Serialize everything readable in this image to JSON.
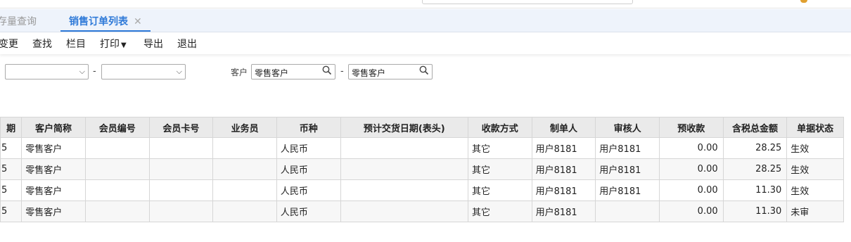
{
  "tabs": {
    "inactive_label": "存量查询",
    "active_label": "销售订单列表",
    "close_glyph": "✕"
  },
  "toolbar": {
    "change": "变更",
    "find": "查找",
    "columns": "栏目",
    "print": "打印",
    "export": "导出",
    "exit": "退出"
  },
  "filters": {
    "customer_label": "客户",
    "dash": "-",
    "customer_from": "零售客户",
    "customer_to": "零售客户"
  },
  "table": {
    "headers": [
      "期",
      "客户简称",
      "会员编号",
      "会员卡号",
      "业务员",
      "币种",
      "预计交货日期(表头)",
      "收款方式",
      "制单人",
      "审核人",
      "预收款",
      "含税总金额",
      "单据状态"
    ],
    "rows": [
      [
        "5",
        "零售客户",
        "",
        "",
        "",
        "人民币",
        "",
        "其它",
        "用户8181",
        "用户8181",
        "0.00",
        "28.25",
        "生效"
      ],
      [
        "5",
        "零售客户",
        "",
        "",
        "",
        "人民币",
        "",
        "其它",
        "用户8181",
        "用户8181",
        "0.00",
        "28.25",
        "生效"
      ],
      [
        "5",
        "零售客户",
        "",
        "",
        "",
        "人民币",
        "",
        "其它",
        "用户8181",
        "用户8181",
        "0.00",
        "11.30",
        "生效"
      ],
      [
        "5",
        "零售客户",
        "",
        "",
        "",
        "人民币",
        "",
        "其它",
        "用户8181",
        "",
        "0.00",
        "11.30",
        "未审"
      ]
    ]
  },
  "colors": {
    "accent": "#2f7ad8",
    "header_bg": "#eaeaea",
    "tabbar_bg": "#eef3fb"
  }
}
